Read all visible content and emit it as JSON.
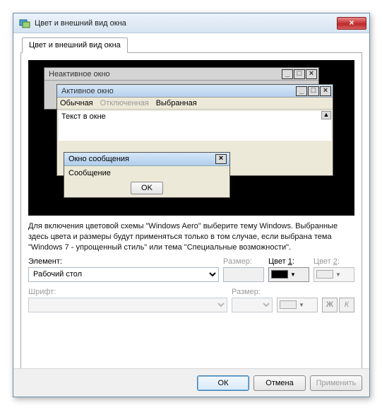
{
  "window": {
    "title": "Цвет и внешний вид окна",
    "close_glyph": "×"
  },
  "tab": {
    "label": "Цвет и внешний вид окна"
  },
  "preview": {
    "inactive_title": "Неактивное окно",
    "active_title": "Активное окно",
    "menu": {
      "normal": "Обычная",
      "disabled": "Отключенная",
      "selected": "Выбранная"
    },
    "text_in_window": "Текст в окне",
    "msg_title": "Окно сообщения",
    "msg_body": "Сообщение",
    "msg_ok": "OK",
    "ctrl_min": "_",
    "ctrl_max": "□",
    "ctrl_close": "×",
    "sb_up": "▲"
  },
  "description": "Для включения цветовой схемы \"Windows Aero\" выберите тему Windows. Выбранные здесь цвета и размеры будут применяться только в том случае, если выбрана тема \"Windows 7 - упрощенный стиль\" или тема \"Специальные возможности\".",
  "labels": {
    "element": "Элемент:",
    "size": "Размер:",
    "color1_pre": "Цвет ",
    "color1_key": "1",
    "color1_post": ":",
    "color2_pre": "Цвет ",
    "color2_key": "2",
    "color2_post": ":",
    "font": "Шрифт:",
    "bold": "Ж",
    "italic": "К"
  },
  "element_combo": {
    "selected": "Рабочий стол"
  },
  "color1_swatch": "#000000",
  "footer": {
    "ok": "ОК",
    "cancel": "Отмена",
    "apply": "Применить"
  }
}
